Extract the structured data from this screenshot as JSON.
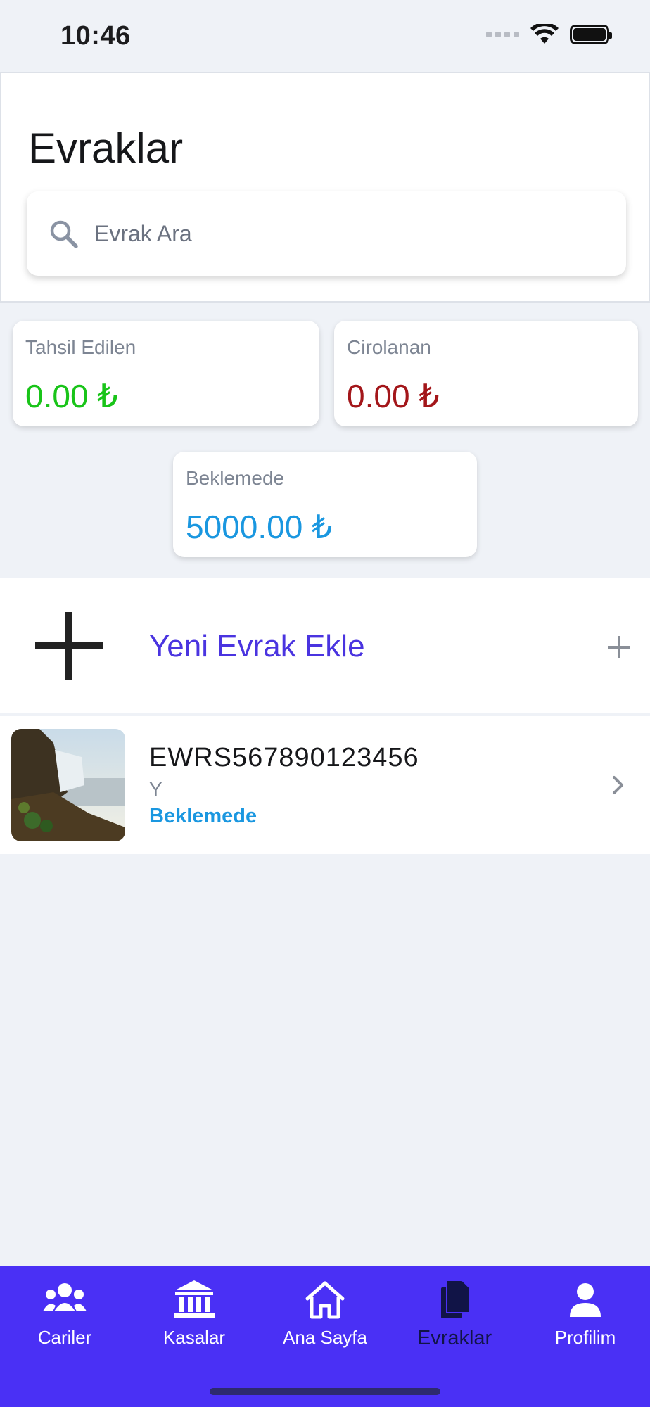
{
  "status_bar": {
    "time": "10:46"
  },
  "header": {
    "title": "Evraklar",
    "search": {
      "placeholder": "Evrak Ara",
      "value": ""
    }
  },
  "stats": {
    "collected": {
      "label": "Tahsil Edilen",
      "value": "0.00 ₺",
      "color": "#19c419"
    },
    "endorsed": {
      "label": "Cirolanan",
      "value": "0.00 ₺",
      "color": "#a3161a"
    },
    "pending": {
      "label": "Beklemede",
      "value": "5000.00 ₺",
      "color": "#1a97e0"
    }
  },
  "add_new": {
    "label": "Yeni Evrak Ekle"
  },
  "documents": [
    {
      "code": "EWRS567890123456",
      "subtitle": "Y",
      "status": "Beklemede",
      "thumbnail": "waterfall-image"
    }
  ],
  "tabs": [
    {
      "label": "Cariler",
      "icon": "users-icon",
      "active": false
    },
    {
      "label": "Kasalar",
      "icon": "bank-icon",
      "active": false
    },
    {
      "label": "Ana Sayfa",
      "icon": "home-icon",
      "active": false
    },
    {
      "label": "Evraklar",
      "icon": "documents-icon",
      "active": true
    },
    {
      "label": "Profilim",
      "icon": "user-icon",
      "active": false
    }
  ],
  "colors": {
    "accent": "#4a30f5",
    "add_label": "#4a34e0",
    "background": "#eff2f7"
  }
}
